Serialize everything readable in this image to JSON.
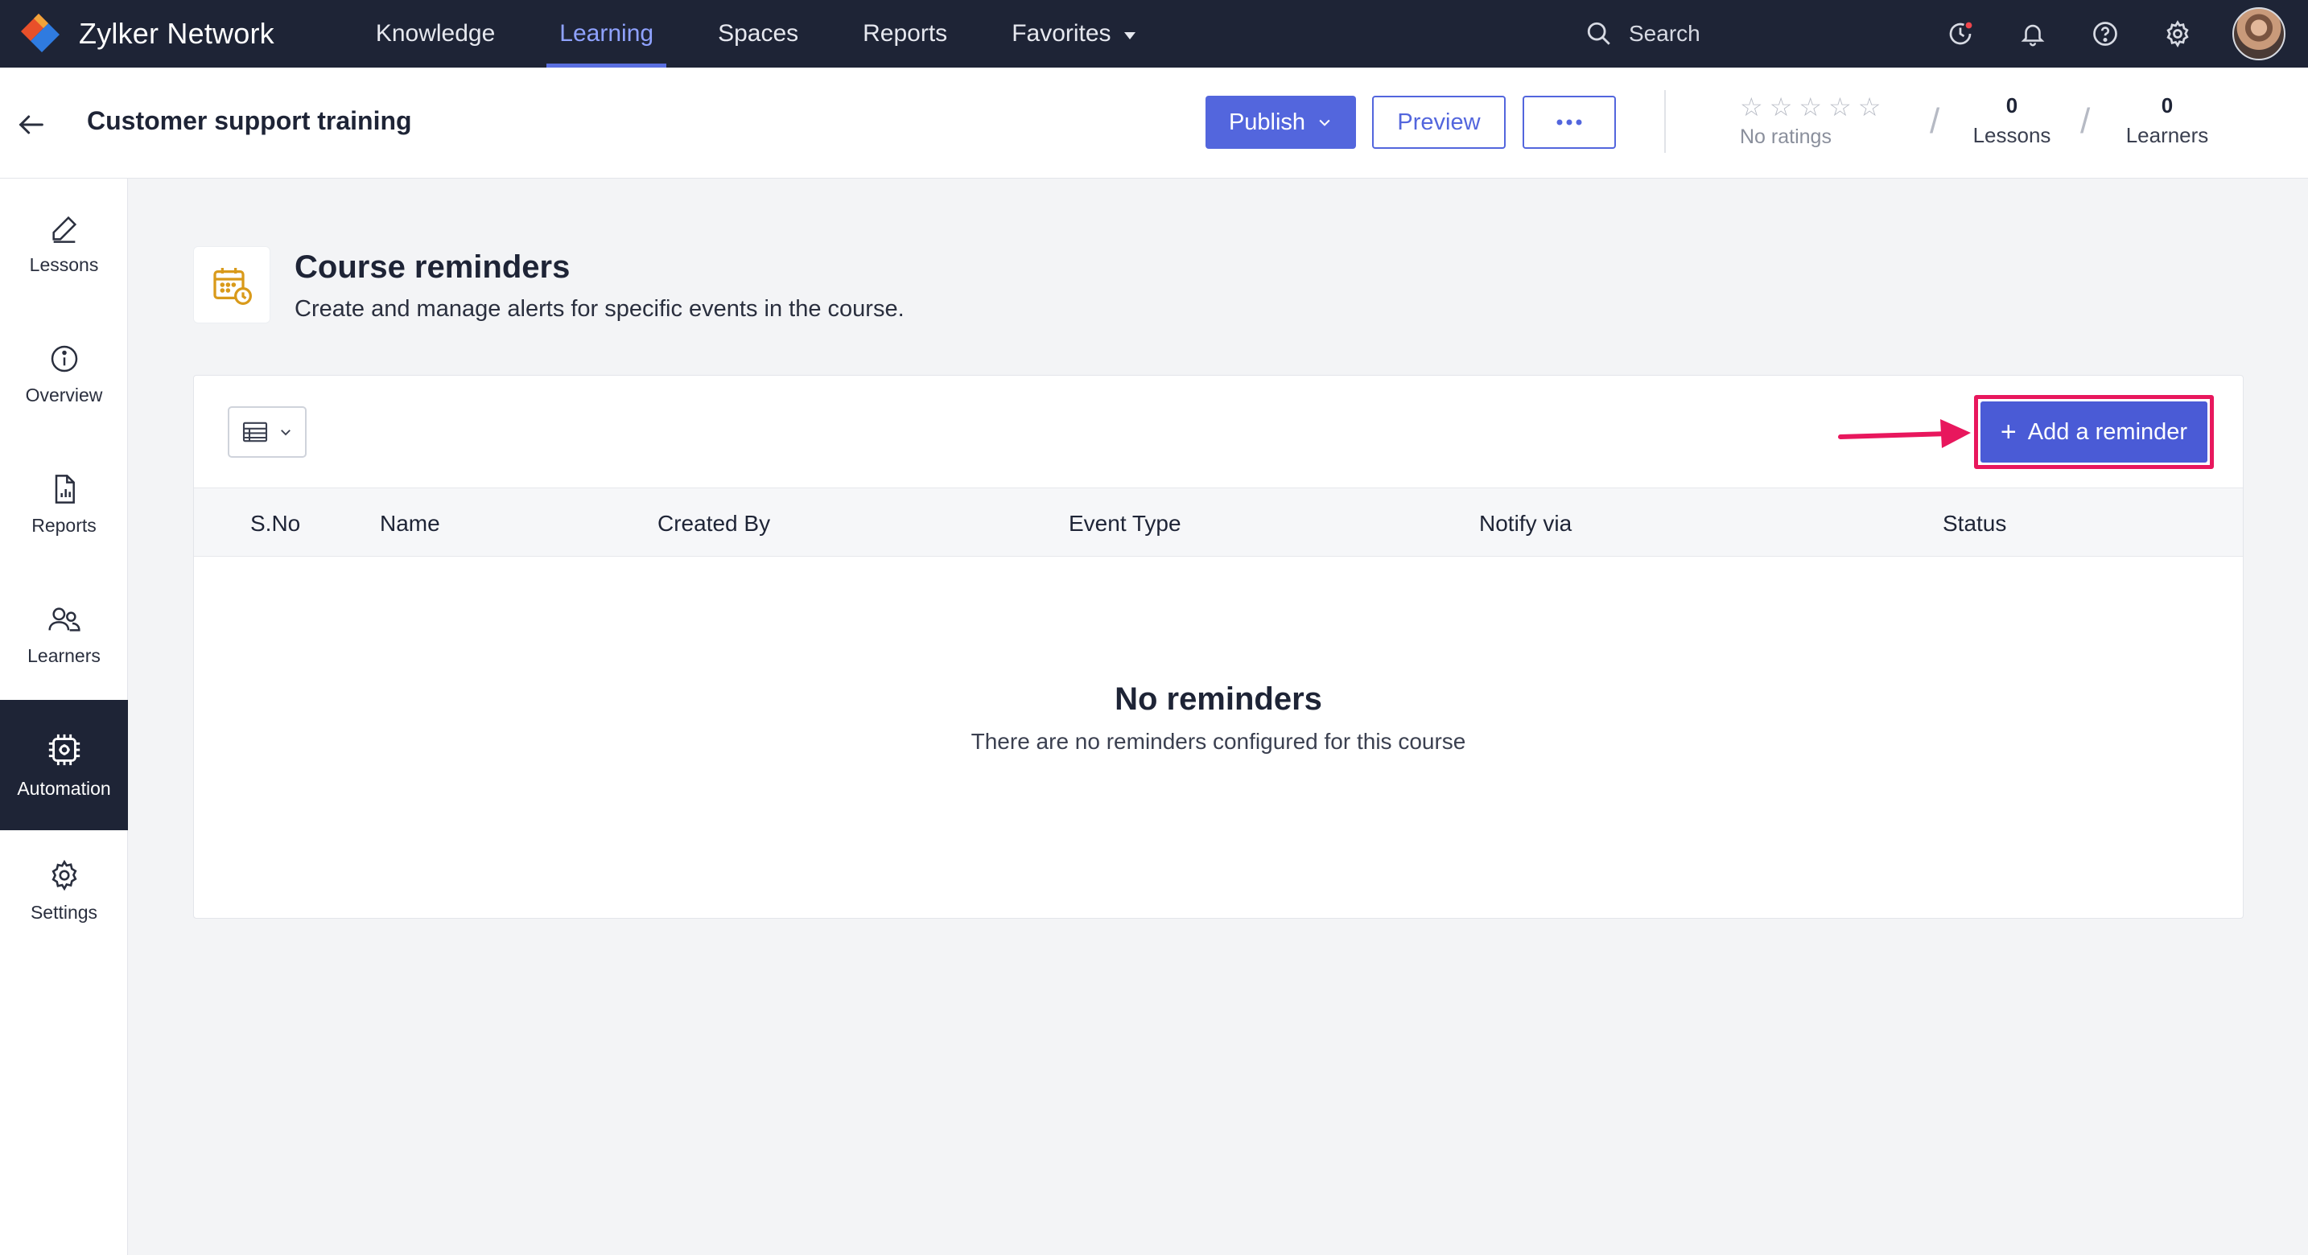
{
  "app": {
    "brand": "Zylker Network"
  },
  "nav": {
    "items": [
      {
        "label": "Knowledge"
      },
      {
        "label": "Learning"
      },
      {
        "label": "Spaces"
      },
      {
        "label": "Reports"
      },
      {
        "label": "Favorites"
      }
    ],
    "active": "Learning",
    "search_label": "Search"
  },
  "header": {
    "course_title": "Customer support training",
    "publish_label": "Publish",
    "preview_label": "Preview",
    "ratings_label": "No ratings",
    "lessons_count": "0",
    "lessons_label": "Lessons",
    "learners_count": "0",
    "learners_label": "Learners"
  },
  "sidebar": {
    "items": [
      {
        "label": "Lessons",
        "icon": "pencil-icon"
      },
      {
        "label": "Overview",
        "icon": "info-icon"
      },
      {
        "label": "Reports",
        "icon": "report-file-icon"
      },
      {
        "label": "Learners",
        "icon": "users-icon"
      },
      {
        "label": "Automation",
        "icon": "automation-chip-icon"
      },
      {
        "label": "Settings",
        "icon": "gear-icon"
      }
    ],
    "active": "Automation"
  },
  "page": {
    "title": "Course reminders",
    "description": "Create and manage alerts for specific events in the course."
  },
  "toolbar": {
    "add_label": "Add a reminder"
  },
  "table": {
    "columns": [
      "S.No",
      "Name",
      "Created By",
      "Event Type",
      "Notify via",
      "Status"
    ]
  },
  "empty_state": {
    "title": "No reminders",
    "subtitle": "There are no reminders configured for this course"
  },
  "colors": {
    "nav_bg": "#1e2436",
    "accent": "#5366dd",
    "highlight": "#e8175d",
    "active_nav": "#8fa2ff"
  }
}
